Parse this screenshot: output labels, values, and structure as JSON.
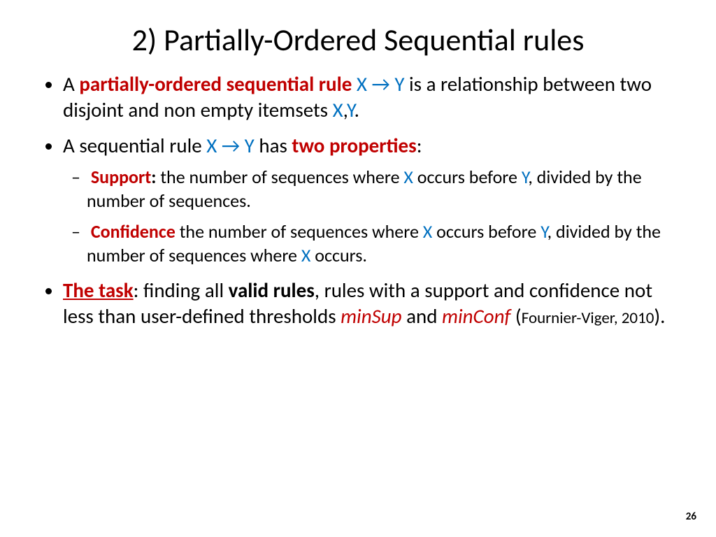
{
  "title": "2) Partially-Ordered Sequential rules",
  "bullet1": {
    "t1": "A ",
    "t2": "partially-ordered sequential rule ",
    "t3": "X → Y",
    "t4": " is a relationship between two disjoint and non empty itemsets ",
    "t5": "X",
    "t6": ",",
    "t7": "Y",
    "t8": "."
  },
  "bullet2": {
    "t1": "A sequential rule ",
    "t2": "X → Y",
    "t3": "  has ",
    "t4": "two properties",
    "t5": ":"
  },
  "sub1": {
    "t1": "Support",
    "t2": ": ",
    "t3": "the number of sequences where ",
    "t4": "X",
    "t5": " occurs before ",
    "t6": "Y",
    "t7": ", divided by the number of sequences."
  },
  "sub2": {
    "t1": "Confidence",
    "t2": " the number of sequences where ",
    "t3": "X",
    "t4": " occurs before ",
    "t5": "Y",
    "t6": ", divided by the number of sequences where ",
    "t7": "X",
    "t8": " occurs."
  },
  "bullet3": {
    "t1": "The task",
    "t2": ": finding all ",
    "t3": "valid rules",
    "t4": ", rules with a support and confidence not less than user-defined thresholds ",
    "t5": "minSup",
    "t6": " and ",
    "t7": "minConf ",
    "t8": " (",
    "t9": "Fournier-Viger, 2010",
    "t10": ")."
  },
  "pageNumber": "26"
}
